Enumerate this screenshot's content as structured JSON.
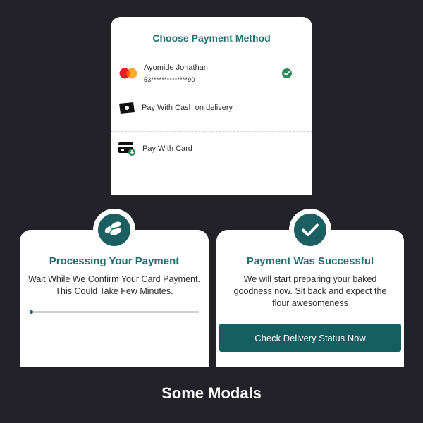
{
  "payment_modal": {
    "title": "Choose Payment Method",
    "options": [
      {
        "name": "Ayomide Jonathan",
        "number": "53**************90",
        "icon": "mastercard-icon",
        "selected": true
      },
      {
        "label": "Pay With Cash on delivery",
        "icon": "cash-icon"
      },
      {
        "label": "Pay With Card",
        "icon": "add-card-icon"
      }
    ]
  },
  "processing_modal": {
    "title": "Processing Your Payment",
    "message": "Wait While We Confirm Your Card Payment. This Could Take Few Minutes.",
    "icon": "coins-icon",
    "progress": 0.02
  },
  "success_modal": {
    "title": "Payment Was Successful",
    "message": "We will start preparing your baked goodness now. Sit back and expect the flour awesomeness",
    "icon": "check-icon",
    "button_label": "Check Delivery Status Now"
  },
  "footer": {
    "title": "Some Modals"
  },
  "colors": {
    "accent": "#1f6d71",
    "button": "#155f63",
    "background": "#232229"
  }
}
